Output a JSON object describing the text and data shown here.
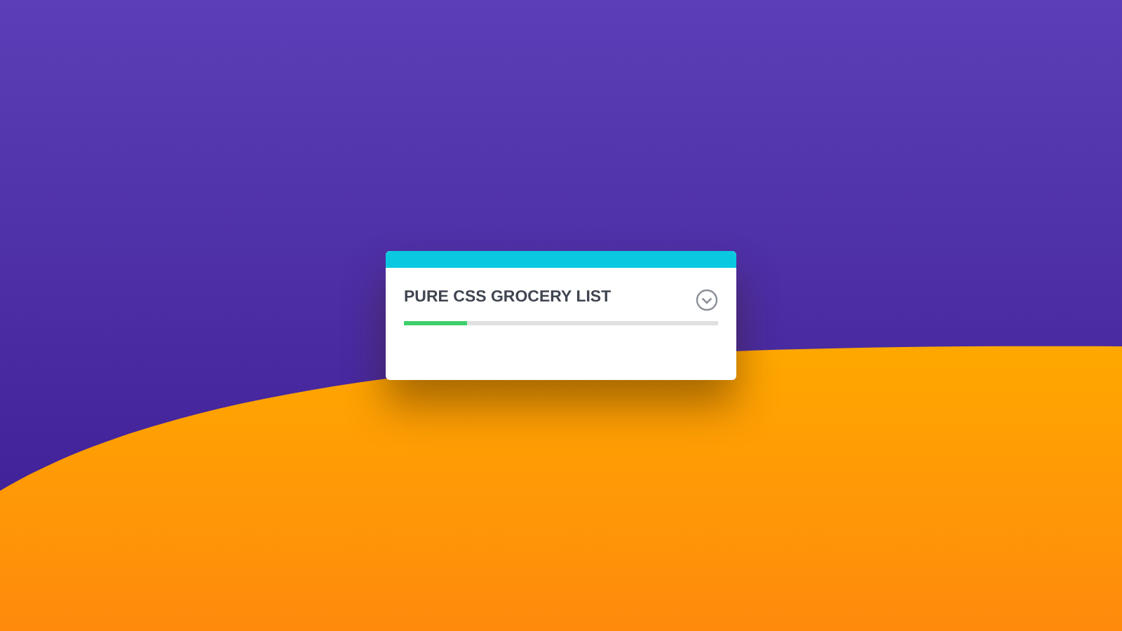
{
  "card": {
    "title": "PURE CSS GROCERY LIST",
    "expanded": false,
    "progress": {
      "level": 0.2
    }
  }
}
